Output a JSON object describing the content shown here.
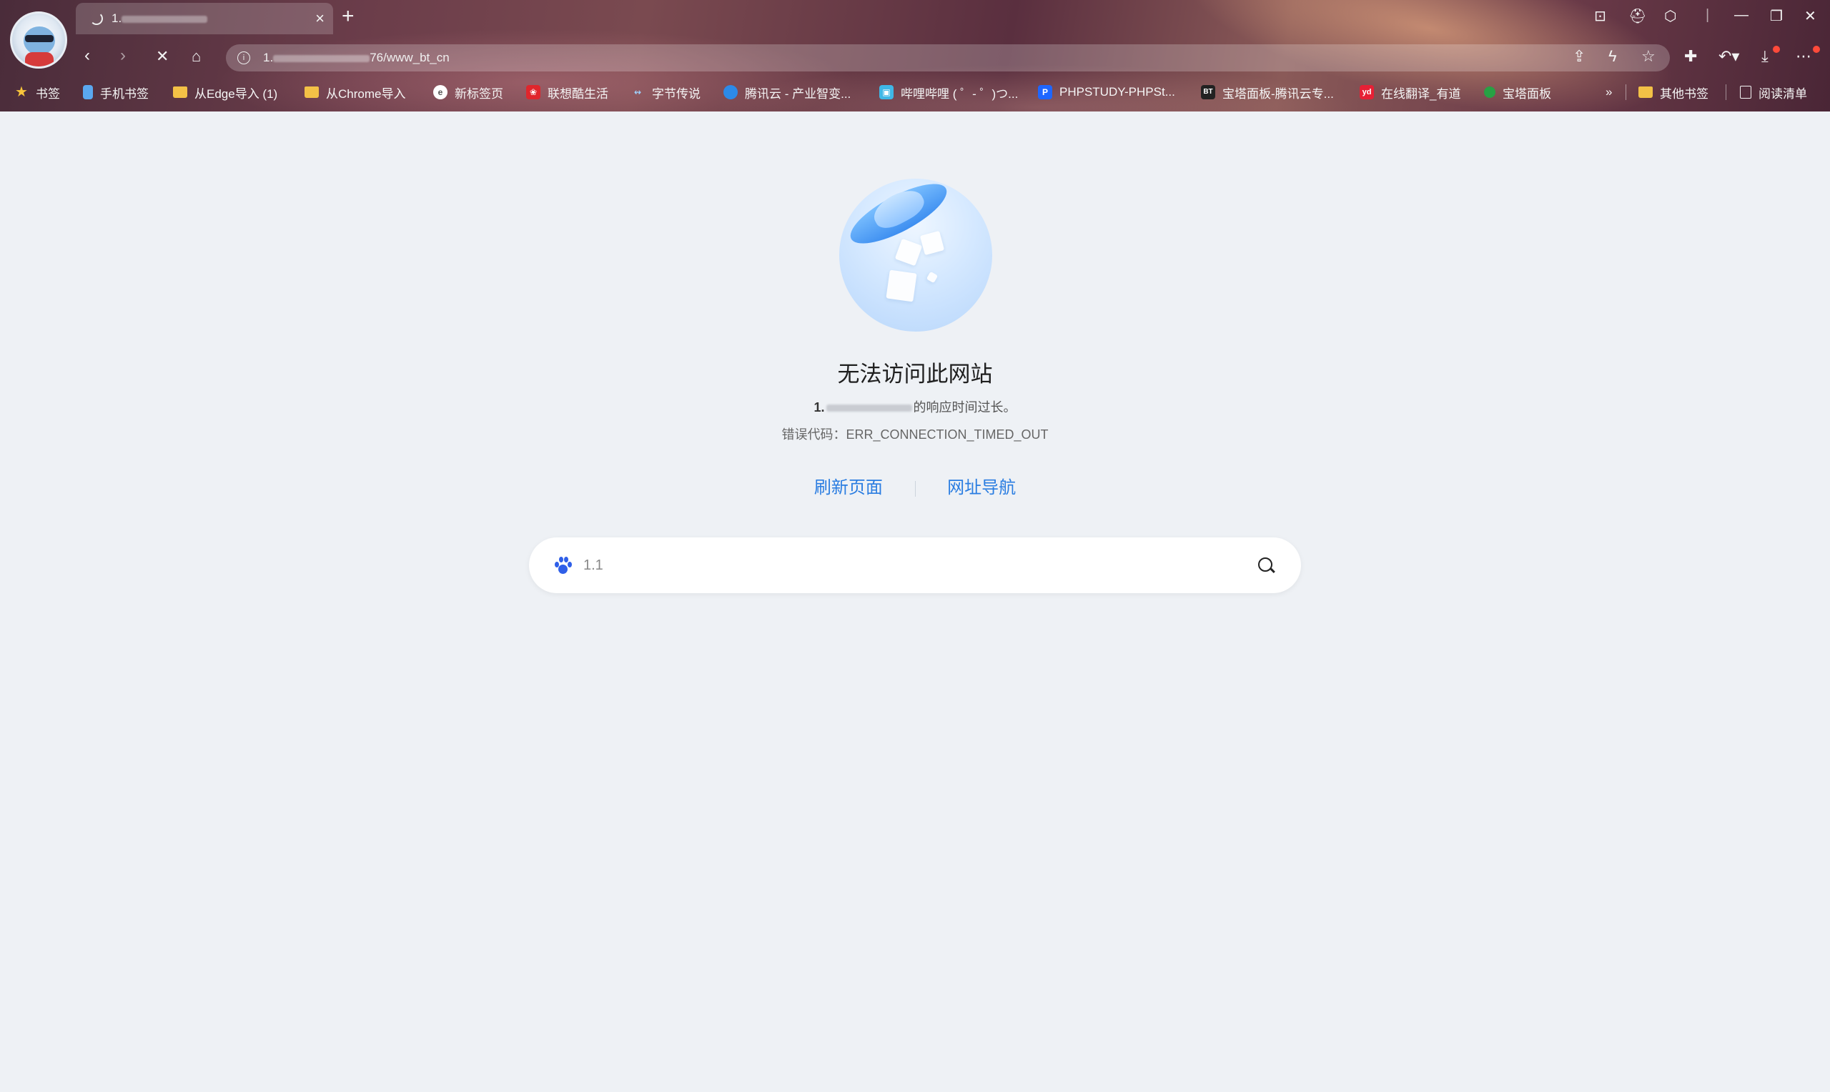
{
  "tab": {
    "title": "1.",
    "close": "×",
    "new_tab": "+"
  },
  "address_bar": {
    "url_prefix": "1.",
    "url_suffix": "76/www_bt_cn"
  },
  "bookmarks": [
    {
      "label": "书签",
      "icon": "star-icon"
    },
    {
      "label": "手机书签",
      "icon": "phone-icon"
    },
    {
      "label": "从Edge导入 (1)",
      "icon": "folder-icon"
    },
    {
      "label": "从Chrome导入",
      "icon": "folder-icon"
    },
    {
      "label": "新标签页",
      "icon": "newtab-icon"
    },
    {
      "label": "联想酷生活",
      "icon": "lenovo-icon"
    },
    {
      "label": "字节传说",
      "icon": "bytes-icon"
    },
    {
      "label": "腾讯云 - 产业智变...",
      "icon": "tencent-cloud-icon"
    },
    {
      "label": "哔哩哔哩 ( ゜- ゜)つ...",
      "icon": "bilibili-icon"
    },
    {
      "label": "PHPSTUDY-PHPSt...",
      "icon": "phpstudy-icon"
    },
    {
      "label": "宝塔面板-腾讯云专...",
      "icon": "bt-icon"
    },
    {
      "label": "在线翻译_有道",
      "icon": "youdao-icon"
    },
    {
      "label": "宝塔面板",
      "icon": "bt-green-icon"
    }
  ],
  "bookmarks_more": "»",
  "other_bookmarks": "其他书签",
  "reading_list": "阅读清单",
  "error": {
    "title": "无法访问此网站",
    "desc_host": "1.",
    "desc_tail": "的响应时间过长。",
    "code": "错误代码：ERR_CONNECTION_TIMED_OUT"
  },
  "actions": {
    "refresh": "刷新页面",
    "nav": "网址导航"
  },
  "search": {
    "value": "1.1"
  },
  "colors": {
    "link": "#2a7de1",
    "page_bg": "#eef1f5"
  }
}
